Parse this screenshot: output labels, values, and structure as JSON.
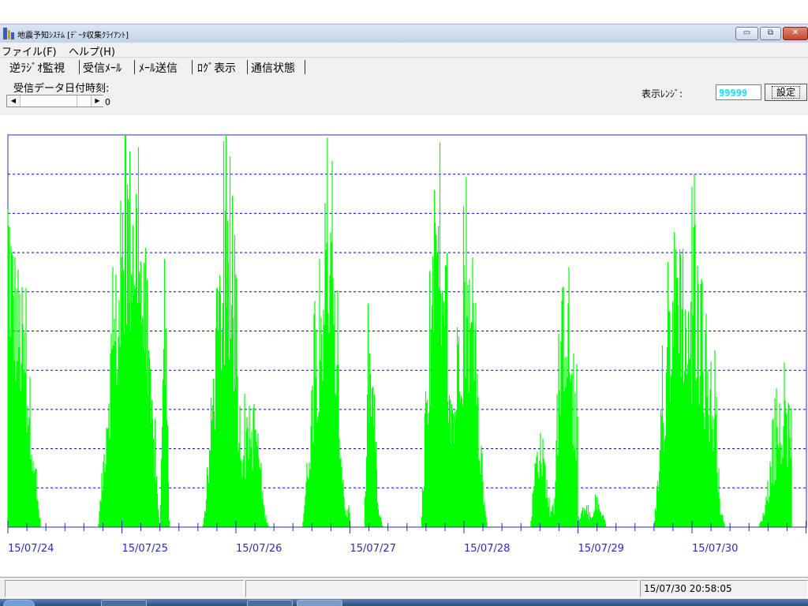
{
  "window": {
    "title": "地震予知ｼｽﾃﾑ [ﾃﾞｰﾀ収集ｸﾗｲｱﾝﾄ]",
    "min_glyph": "▭",
    "max_glyph": "⧉",
    "close_glyph": "✕"
  },
  "menu": [
    {
      "label": "ファイル(F)"
    },
    {
      "label": "ヘルプ(H)"
    }
  ],
  "tabs": [
    {
      "label": "逆ﾗｼﾞｵ監視"
    },
    {
      "label": "受信ﾒｰﾙ"
    },
    {
      "label": "ﾒｰﾙ送信"
    },
    {
      "label": "ﾛｸﾞ表示"
    },
    {
      "label": "通信状態"
    }
  ],
  "toolbar": {
    "date_label": "受信データ日付時刻:",
    "scroll_value": "0",
    "range_label": "表示ﾚﾝｼﾞ:",
    "range_value": "99999",
    "set_button": "設定"
  },
  "chart_data": {
    "type": "area",
    "x_tick_labels": [
      "15/07/24",
      "15/07/25",
      "15/07/26",
      "15/07/27",
      "15/07/28",
      "15/07/29",
      "15/07/30"
    ],
    "y_range": [
      0,
      99999
    ],
    "y_gridlines": 10,
    "series_color": "#00ff00",
    "grid_color": "#0000cc",
    "days": [
      {
        "label": "15/07/24",
        "activity": [
          100,
          78,
          70,
          62,
          48,
          35,
          12,
          0,
          0,
          0,
          0,
          0,
          0,
          0,
          0,
          0,
          0,
          0,
          0,
          0,
          18,
          42,
          60,
          70
        ]
      },
      {
        "label": "15/07/25",
        "activity": [
          88,
          100,
          100,
          100,
          85,
          62,
          40,
          22,
          0,
          65,
          0,
          0,
          0,
          0,
          0,
          0,
          0,
          0,
          12,
          40,
          60,
          78,
          82,
          70
        ]
      },
      {
        "label": "15/07/26",
        "activity": [
          55,
          30,
          25,
          28,
          35,
          22,
          5,
          0,
          0,
          0,
          0,
          0,
          0,
          0,
          0,
          18,
          40,
          58,
          70,
          92,
          82,
          58,
          30,
          5
        ]
      },
      {
        "label": "15/07/27",
        "activity": [
          0,
          0,
          0,
          0,
          52,
          40,
          5,
          0,
          0,
          0,
          0,
          0,
          0,
          0,
          0,
          0,
          30,
          55,
          90,
          72,
          58,
          50,
          35,
          68
        ]
      },
      {
        "label": "15/07/28",
        "activity": [
          76,
          72,
          55,
          40,
          12,
          0,
          0,
          0,
          0,
          0,
          0,
          0,
          0,
          0,
          0,
          20,
          28,
          20,
          5,
          5,
          40,
          72,
          72,
          35
        ]
      },
      {
        "label": "15/07/29",
        "activity": [
          2,
          6,
          5,
          3,
          8,
          4,
          0,
          0,
          0,
          0,
          0,
          0,
          0,
          0,
          0,
          0,
          0,
          18,
          40,
          58,
          74,
          88,
          78,
          62
        ]
      },
      {
        "label": "15/07/30",
        "activity": [
          92,
          72,
          62,
          50,
          44,
          32,
          6,
          0,
          0,
          0,
          0,
          0,
          0,
          0,
          0,
          4,
          12,
          22,
          28,
          32,
          33
        ]
      }
    ]
  },
  "status": {
    "pane1": "",
    "pane2": "",
    "pane3": "15/07/30 20:58:05"
  }
}
